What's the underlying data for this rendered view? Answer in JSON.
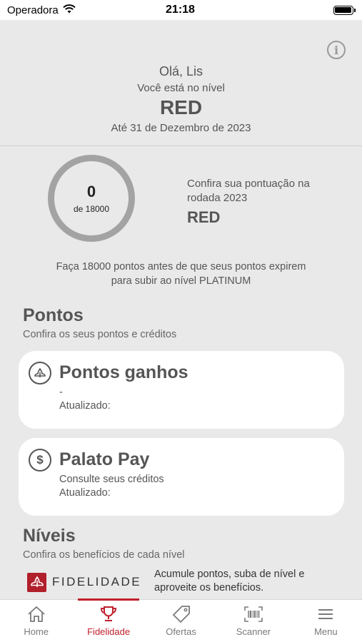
{
  "status_bar": {
    "carrier": "Operadora",
    "time": "21:18"
  },
  "header": {
    "greeting": "Olá, Lis",
    "level_intro": "Você está no nível",
    "level": "RED",
    "valid_until": "Até 31 de Dezembro de 2023"
  },
  "score": {
    "points": "0",
    "target": "de 18000",
    "info_text": "Confira sua pontuação na rodada 2023",
    "level": "RED",
    "progress_fraction": 0
  },
  "promo": {
    "line1": "Faça 18000 pontos antes de que seus pontos expirem",
    "line2": "para subir ao nível PLATINUM"
  },
  "points_section": {
    "title": "Pontos",
    "subtitle": "Confira os seus pontos e créditos",
    "cards": [
      {
        "icon": "points-emblem-icon",
        "title": "Pontos ganhos",
        "value": "-",
        "updated": "Atualizado:"
      },
      {
        "icon": "dollar-icon",
        "title": "Palato Pay",
        "value": "Consulte seus créditos",
        "updated": "Atualizado:"
      }
    ]
  },
  "levels_section": {
    "title": "Níveis",
    "subtitle": "Confira os benefícios de cada nível",
    "brand": "FIDELIDADE",
    "description": "Acumule pontos, suba de nível e aproveite os benefícios."
  },
  "tabs": [
    {
      "label": "Home",
      "icon": "home-icon",
      "active": false
    },
    {
      "label": "Fidelidade",
      "icon": "trophy-icon",
      "active": true
    },
    {
      "label": "Ofertas",
      "icon": "tag-icon",
      "active": false
    },
    {
      "label": "Scanner",
      "icon": "barcode-icon",
      "active": false
    },
    {
      "label": "Menu",
      "icon": "menu-icon",
      "active": false
    }
  ],
  "colors": {
    "accent": "#c0202c",
    "background": "#e9e9e9",
    "ring": "#a3a3a3"
  }
}
